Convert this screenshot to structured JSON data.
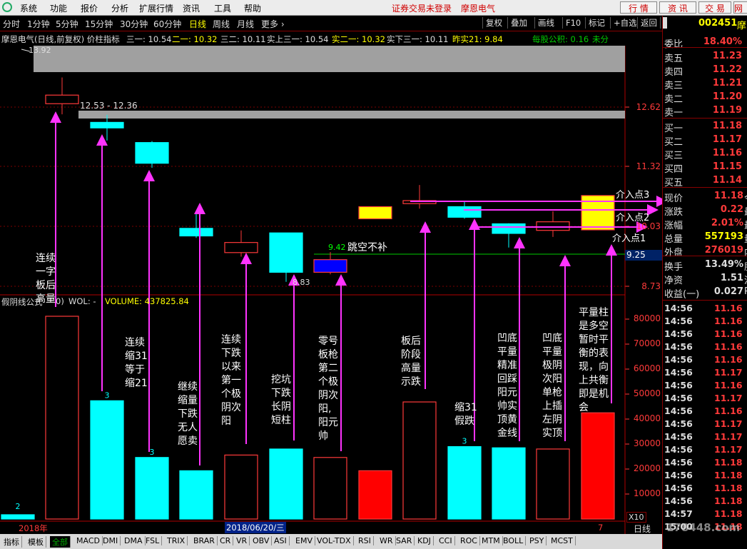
{
  "menu": {
    "items": [
      "系统",
      "功能",
      "报价",
      "分析",
      "扩展行情",
      "资讯",
      "工具",
      "帮助"
    ],
    "status": "证券交易未登录",
    "stock_name": "摩恩电气",
    "buttons": [
      "行 情",
      "资 讯",
      "交 易",
      "网"
    ]
  },
  "timeframes": {
    "items": [
      "分时",
      "1分钟",
      "5分钟",
      "15分钟",
      "30分钟",
      "60分钟",
      "日线",
      "周线",
      "月线",
      "更多 ›"
    ],
    "active": "日线"
  },
  "toolbar": {
    "items": [
      "复权",
      "叠加",
      "画线",
      "F10",
      "标记",
      "+自选",
      "返回"
    ]
  },
  "info": {
    "title": "摩恩电气(日线,前复权) 价柱指标",
    "s1": "三一: 10.54",
    "s2": "二一: 10.32",
    "s3": "三二: 10.11",
    "s4": "实上三一: 10.54",
    "s5": "实二一: 10.32",
    "s6": "实下三一: 10.11",
    "s7": "昨实21: 9.84",
    "s8": "每股公积: 0.16",
    "s9": "未分"
  },
  "quote": {
    "code": "002451",
    "name_short": "摩",
    "webi_label": "委比",
    "webi": "18.40%",
    "sells": [
      {
        "label": "卖五",
        "price": "11.23"
      },
      {
        "label": "卖四",
        "price": "11.22"
      },
      {
        "label": "卖三",
        "price": "11.21"
      },
      {
        "label": "卖二",
        "price": "11.20"
      },
      {
        "label": "卖一",
        "price": "11.19"
      }
    ],
    "buys": [
      {
        "label": "买一",
        "price": "11.18"
      },
      {
        "label": "买二",
        "price": "11.17"
      },
      {
        "label": "买三",
        "price": "11.16"
      },
      {
        "label": "买四",
        "price": "11.15"
      },
      {
        "label": "买五",
        "price": "11.14"
      }
    ],
    "stats": [
      {
        "label": "现价",
        "value": "11.18",
        "suffix": "今",
        "color": "#ff3a3a"
      },
      {
        "label": "涨跌",
        "value": "0.22",
        "suffix": "最",
        "color": "#ff3a3a"
      },
      {
        "label": "涨幅",
        "value": "2.01%",
        "suffix": "最",
        "color": "#ff3a3a"
      },
      {
        "label": "总量",
        "value": "557193",
        "suffix": "量",
        "color": "#ffff00"
      },
      {
        "label": "外盘",
        "value": "276019",
        "suffix": "内",
        "color": "#ff3a3a"
      },
      {
        "label": "换手",
        "value": "13.49%",
        "suffix": "股",
        "color": "#ddd"
      },
      {
        "label": "净资",
        "value": "1.51",
        "suffix": "流",
        "color": "#ddd"
      },
      {
        "label": "收益(一)",
        "value": "0.027",
        "suffix": "P",
        "color": "#ddd"
      }
    ],
    "ticks": [
      {
        "t": "14:56",
        "p": "11.16"
      },
      {
        "t": "14:56",
        "p": "11.16"
      },
      {
        "t": "14:56",
        "p": "11.16"
      },
      {
        "t": "14:56",
        "p": "11.16"
      },
      {
        "t": "14:56",
        "p": "11.16"
      },
      {
        "t": "14:56",
        "p": "11.17"
      },
      {
        "t": "14:56",
        "p": "11.16"
      },
      {
        "t": "14:56",
        "p": "11.17"
      },
      {
        "t": "14:56",
        "p": "11.16"
      },
      {
        "t": "14:56",
        "p": "11.17"
      },
      {
        "t": "14:56",
        "p": "11.17"
      },
      {
        "t": "14:56",
        "p": "11.17"
      },
      {
        "t": "14:56",
        "p": "11.18"
      },
      {
        "t": "14:56",
        "p": "11.18"
      },
      {
        "t": "14:56",
        "p": "11.18"
      },
      {
        "t": "14:56",
        "p": "11.18"
      },
      {
        "t": "14:57",
        "p": "11.18"
      },
      {
        "t": "15:00",
        "p": "11.18"
      }
    ]
  },
  "chart_data": {
    "type": "candlestick",
    "price_axis": {
      "ticks": [
        "12.62",
        "11.32",
        "10.03",
        "8.73"
      ],
      "highlight": "9.25"
    },
    "price_labels": {
      "top_high": "13.92",
      "range": "12.53 - 12.36",
      "low1": "8.83",
      "gap": "9.42"
    },
    "candles": [
      {
        "open": 12.36,
        "close": 12.53,
        "high": 12.88,
        "low": 12.15,
        "type": "red"
      },
      {
        "open": 11.99,
        "close": 11.88,
        "high": 12.14,
        "low": 11.63,
        "type": "cyan"
      },
      {
        "open": 11.59,
        "close": 11.18,
        "high": 11.62,
        "low": 11.09,
        "type": "cyan"
      },
      {
        "open": 9.89,
        "close": 9.74,
        "high": 10.18,
        "low": 9.7,
        "type": "cyan"
      },
      {
        "open": 9.61,
        "close": 9.41,
        "high": 9.85,
        "low": 9.33,
        "type": "red"
      },
      {
        "open": 9.8,
        "close": 9.02,
        "high": 9.8,
        "low": 8.83,
        "type": "cyan"
      },
      {
        "open": 9.27,
        "close": 9.02,
        "high": 9.42,
        "low": 8.98,
        "type": "blue"
      },
      {
        "open": 10.08,
        "close": 10.32,
        "high": 10.32,
        "low": 10.08,
        "type": "yellow"
      },
      {
        "open": 10.38,
        "close": 10.44,
        "high": 10.75,
        "low": 10.28,
        "type": "red"
      },
      {
        "open": 10.11,
        "close": 10.32,
        "high": 10.43,
        "low": 10.08,
        "type": "cyan"
      },
      {
        "open": 9.79,
        "close": 9.98,
        "high": 9.99,
        "low": 9.51,
        "type": "cyan"
      },
      {
        "open": 9.85,
        "close": 10.02,
        "high": 10.23,
        "low": 9.72,
        "type": "red"
      },
      {
        "open": 9.86,
        "close": 10.54,
        "high": 10.54,
        "low": 9.86,
        "type": "yellow"
      }
    ],
    "volume": {
      "label": "WOL: -",
      "name": "VOLUME: 437825.84",
      "indicator_name": "假阴线公式",
      "ticks": [
        "80000",
        "70000",
        "60000",
        "50000",
        "40000",
        "30000",
        "20000",
        "10000"
      ],
      "bars": [
        {
          "v": 2,
          "type": "cyan",
          "lbl": "2"
        },
        {
          "v": 84000,
          "type": "red",
          "lbl": ""
        },
        {
          "v": 49000,
          "type": "cyan",
          "lbl": "3"
        },
        {
          "v": 25500,
          "type": "cyan",
          "lbl": "3"
        },
        {
          "v": 20000,
          "type": "cyan",
          "lbl": ""
        },
        {
          "v": 26500,
          "type": "red",
          "lbl": ""
        },
        {
          "v": 29000,
          "type": "cyan",
          "lbl": ""
        },
        {
          "v": 25500,
          "type": "red",
          "lbl": ""
        },
        {
          "v": 20000,
          "type": "redfill",
          "lbl": ""
        },
        {
          "v": 48500,
          "type": "red",
          "lbl": ""
        },
        {
          "v": 30000,
          "type": "cyan",
          "lbl": "3"
        },
        {
          "v": 29500,
          "type": "cyan",
          "lbl": ""
        },
        {
          "v": 29000,
          "type": "red",
          "lbl": ""
        },
        {
          "v": 44000,
          "type": "redfill",
          "lbl": ""
        }
      ]
    },
    "annotations": {
      "a0": "连续\n一字\n板后\n高量",
      "a2": "连续\n缩31\n等于\n缩21",
      "a3": "继续\n缩量\n下跌\n无人\n愿卖",
      "a4": "连续\n下跌\n以来\n第一\n个极\n阴次\n阳",
      "a5": "挖坑\n下跌\n长阴\n短柱",
      "a6": "零号\n板枪\n第二\n个极\n阴次\n阳,\n阳元\n帅",
      "a8": "板后\n阶段\n高量\n示跌",
      "a9": "缩31\n假跌",
      "a10": "凹底\n平量\n精准\n回踩\n阳元\n帅实\n顶黄\n金线",
      "a11": "凹底\n平量\n极阴\n次阳\n单枪\n上插\n左阴\n实顶",
      "a12": "平量柱\n是多空\n暂时平\n衡的表\n现，向\n上共衡\n即是机\n会",
      "gap_text": "跳空不补",
      "entry1": "介入点1",
      "entry2": "介入点2",
      "entry3": "介入点3"
    },
    "x_labels": {
      "year": "2018年",
      "date": "2018/06/20/三",
      "seven": "7",
      "x10": "X10",
      "period": "日线"
    }
  },
  "bottom_tabs": [
    "指标",
    "模板",
    "全部",
    "MACD",
    "DMI",
    "DMA",
    "FSL",
    "TRIX",
    "BRAR",
    "CR",
    "VR",
    "OBV",
    "ASI",
    "EMV",
    "VOL-TDX",
    "RSI",
    "WR",
    "SAR",
    "KDJ",
    "CCI",
    "ROC",
    "MTM",
    "BOLL",
    "PSY",
    "MCST"
  ],
  "watermark": "178448.com"
}
